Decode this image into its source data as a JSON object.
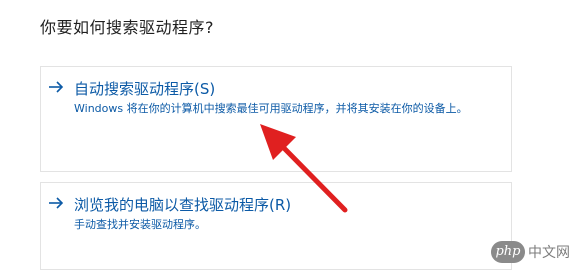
{
  "page": {
    "title": "你要如何搜索驱动程序?"
  },
  "options": [
    {
      "title": "自动搜索驱动程序(S)",
      "description": "Windows 将在你的计算机中搜索最佳可用驱动程序，并将其安装在你的设备上。",
      "icon": "arrow-right-icon"
    },
    {
      "title": "浏览我的电脑以查找驱动程序(R)",
      "description": "手动查找并安装驱动程序。",
      "icon": "arrow-right-icon"
    }
  ],
  "annotation": {
    "icon": "red-pointer-arrow",
    "color": "#e02020"
  },
  "watermark": {
    "logo_text": "php",
    "text": "中文网"
  },
  "colors": {
    "link_blue": "#0c5aa6",
    "text_dark": "#1f1f1f",
    "border": "#e3e3e3"
  }
}
